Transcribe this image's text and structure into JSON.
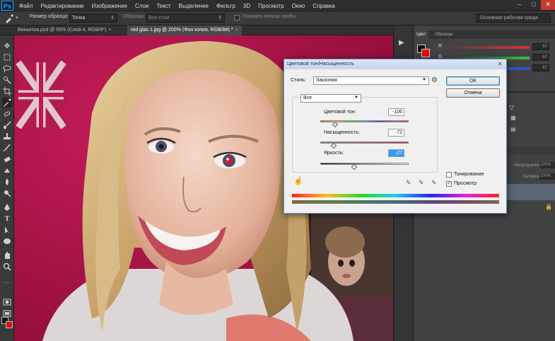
{
  "app": {
    "logo": "Ps"
  },
  "menu": [
    "Файл",
    "Редактирование",
    "Изображение",
    "Слои",
    "Текст",
    "Выделение",
    "Фильтр",
    "3D",
    "Просмотр",
    "Окно",
    "Справка"
  ],
  "options_bar": {
    "sample_size_label": "Размер образца:",
    "sample_size_value": "Точка",
    "samples_label": "Образцы:",
    "samples_value": "Все слои",
    "show_ring_label": "Показать кольцо пробы",
    "workspace": "Основная рабочая среда"
  },
  "tabs": [
    {
      "title": "Виньетка.psd @ 50% (Слой 4, RGB/8*)",
      "close": "×"
    },
    {
      "title": "red glas 1.jpg @ 200% (Фон копия, RGB/8#) *",
      "close": "×"
    }
  ],
  "panels": {
    "color_tab": "Цвет",
    "swatches_tab": "Образцы",
    "channels": [
      {
        "label": "R",
        "value": "67"
      },
      {
        "label": "G",
        "value": "67"
      },
      {
        "label": "B",
        "value": "67"
      }
    ],
    "opacity_label": "Непрозрачность:",
    "opacity_value": "100%",
    "fill_label": "Заливка:",
    "fill_value": "100%"
  },
  "dialog": {
    "title": "Цветовой тон/Насыщенность",
    "style_label": "Стиль:",
    "style_value": "Заказная",
    "ok": "OK",
    "cancel": "Отмена",
    "range_value": "Все",
    "hue_label": "Цветовой тон:",
    "hue_value": "-106",
    "saturation_label": "Насыщенность:",
    "saturation_value": "-72",
    "lightness_label": "Яркость:",
    "lightness_value": "-27",
    "colorize_label": "Тонирование",
    "preview_label": "Просмотр",
    "preview_checked": true,
    "colorize_checked": false
  },
  "colors": {
    "ui_dark": "#282828",
    "toolbar": "#3a3a3a",
    "dialog_bg": "#f0f0f0",
    "highlight": "#3399ff",
    "photo_wall": "#b4124a"
  },
  "icons": [
    "eyedropper-icon",
    "marquee-icon",
    "lasso-icon",
    "quick-select-icon",
    "crop-icon",
    "healing-icon",
    "brush-icon",
    "stamp-icon",
    "history-brush-icon",
    "eraser-icon",
    "gradient-icon",
    "blur-icon",
    "dodge-icon",
    "pen-icon",
    "type-icon",
    "path-select-icon",
    "shape-icon",
    "hand-icon",
    "zoom-icon",
    "quick-mask-icon",
    "screen-mode-icon",
    "gear-icon",
    "target-adjust-icon",
    "close-icon",
    "chevron-down-icon"
  ]
}
